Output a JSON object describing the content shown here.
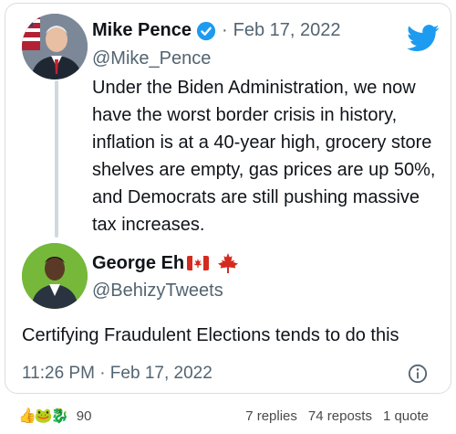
{
  "tweet": {
    "author_name": "Mike Pence",
    "author_handle": "@Mike_Pence",
    "date": "Feb 17, 2022",
    "separator": "·",
    "text": "Under the Biden Administration, we now have the worst border crisis in history, inflation is at a 40-year high, grocery store shelves are empty, gas prices are up 50%, and Democrats are still pushing massive tax increases."
  },
  "reply": {
    "author_name": "George Eh",
    "author_handle": "@BehizyTweets",
    "text": "Certifying Fraudulent Elections tends to do this",
    "timestamp": "11:26 PM · Feb 17, 2022"
  },
  "footer": {
    "reaction_icons": [
      "thumbs-up-emoji",
      "frog-emoji",
      "dragon-emoji"
    ],
    "reaction_count": "90",
    "replies": "7 replies",
    "reposts": "74 reposts",
    "quotes": "1 quote"
  },
  "colors": {
    "twitter_blue": "#1d9bf0",
    "text_primary": "#0f1419",
    "text_secondary": "#536471",
    "canada_red": "#d52b1e"
  }
}
